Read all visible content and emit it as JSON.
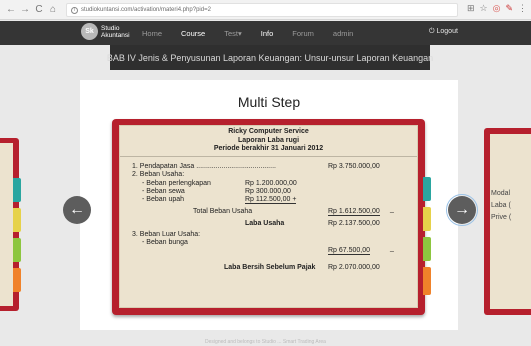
{
  "browser": {
    "url": "studiokuntansi.com/activation/materi4.php?pid=2",
    "back_icon": "←",
    "forward_icon": "→",
    "reload_icon": "C",
    "home_icon": "⌂"
  },
  "site": {
    "logo_abbr": "Sk",
    "logo_line1": "Studio",
    "logo_line2": "Akuntansi",
    "menu": [
      {
        "label": "Home",
        "active": false
      },
      {
        "label": "Course",
        "active": true
      },
      {
        "label": "Test▾",
        "active": false
      },
      {
        "label": "Info",
        "active": true
      },
      {
        "label": "Forum",
        "active": false
      },
      {
        "label": "admin",
        "active": false
      }
    ],
    "logout": "Logout"
  },
  "banner": "BAB IV Jenis & Penyusunan Laporan Keuangan: Unsur-unsur Laporan Keuangan",
  "main": {
    "title": "Multi Step",
    "statement": {
      "company": "Ricky Computer Service",
      "report_name": "Laporan Laba rugi",
      "period": "Periode berakhir 31 Januari 2012",
      "pendapatan_label": "1. Pendapatan Jasa .........................................",
      "pendapatan_value": "Rp 3.750.000,00",
      "beban_usaha_label": "2. Beban Usaha:",
      "beban": [
        {
          "label": "- Beban perlengkapan",
          "value": "Rp  1.200.000,00"
        },
        {
          "label": "- Beban sewa",
          "value": "Rp    300.000,00"
        },
        {
          "label": "- Beban upah",
          "value": "Rp    112.500,00  +"
        }
      ],
      "total_beban_label": "Total Beban Usaha",
      "total_beban_value": "Rp 1.612.500,00",
      "total_minus": "_",
      "laba_usaha_label": "Laba Usaha",
      "laba_usaha_value": "Rp 2.137.500,00",
      "beban_luar_label": "3. Beban Luar Usaha:",
      "beban_bunga_label": "- Beban bunga",
      "beban_bunga_value": "Rp      67.500,00",
      "bunga_minus": "_",
      "laba_bersih_label": "Laba Bersih Sebelum Pajak",
      "laba_bersih_value": "Rp 2.070.000,00"
    },
    "right_card": {
      "line1": "Modal",
      "line2": "Laba (",
      "line3": "Prive ("
    }
  },
  "footer": "Designed and belongs to Studio ... Smart Trading Area",
  "colors": {
    "board_red": "#b6202d",
    "paper": "#ece3cf",
    "tab_teal": "#2aa6a0",
    "tab_yellow": "#e6d24a",
    "tab_green": "#8dc63f",
    "tab_orange": "#f0822a"
  }
}
